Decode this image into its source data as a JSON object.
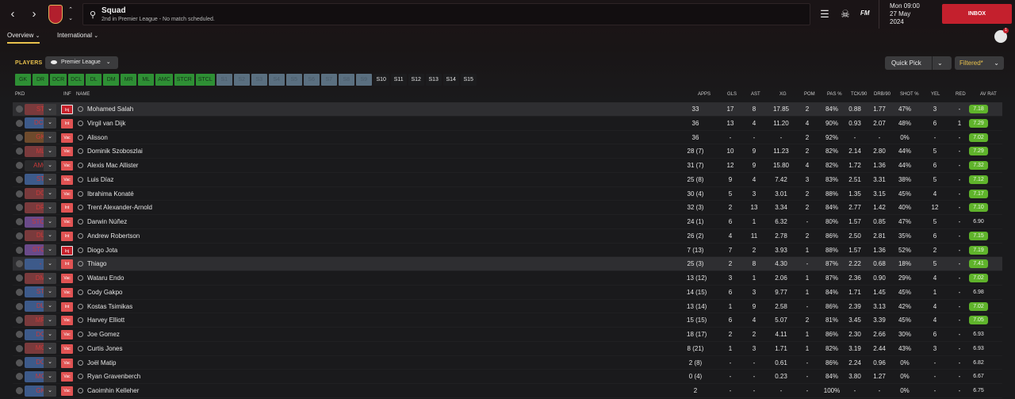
{
  "topbar": {
    "back_icon": "chevron-left",
    "forward_icon": "chevron-right",
    "club_crest": "liverpool-crest",
    "title": "Squad",
    "subtitle": "2nd in Premier League - No match scheduled.",
    "menu_icon": "hamburger-menu",
    "time": "Mon 09:00",
    "date": "27 May",
    "year": "2024",
    "fm_label": "FM",
    "inbox_label": "INBOX",
    "inbox_color": "#c4202d"
  },
  "tabs": [
    {
      "label": "Overview"
    },
    {
      "label": "International"
    }
  ],
  "notification_count": "1",
  "filters": {
    "players_label": "PLAYERS",
    "competition": "Premier League",
    "quick_pick": "Quick Pick",
    "filtered": "Filtered*",
    "positions": [
      "GK",
      "DR",
      "DCR",
      "DCL",
      "DL",
      "DM",
      "MR",
      "ML",
      "AMC",
      "STCR",
      "STCL",
      "S1",
      "S2",
      "S3",
      "S4",
      "S5",
      "S6",
      "S7",
      "S8",
      "S9",
      "S10",
      "S11",
      "S12",
      "S13",
      "S14",
      "S15"
    ]
  },
  "table": {
    "headers": {
      "pkd": "PKD",
      "inf": "INF",
      "name": "NAME",
      "apps": "APPS",
      "gls": "GLS",
      "ast": "AST",
      "xg": "XG",
      "pom": "POM",
      "pas": "PAS %",
      "tck": "TCK/90",
      "drb": "DRB/90",
      "shot": "SHOT %",
      "yel": "YEL",
      "red": "RED",
      "avrat": "AV RAT"
    },
    "rows": [
      {
        "pos": "ST",
        "pos_color": "#7a3a3c",
        "inf": "Inj",
        "name": "Mohamed Salah",
        "apps": "33",
        "gls": "17",
        "ast": "8",
        "xg": "17.85",
        "pom": "2",
        "pas": "84%",
        "tck": "0.88",
        "drb": "1.77",
        "shot": "47%",
        "yel": "3",
        "red": "-",
        "avrat": "7.18"
      },
      {
        "pos": "DCL",
        "pos_color": "#3d5a8a",
        "inf": "Int",
        "name": "Virgil van Dijk",
        "apps": "36",
        "gls": "13",
        "ast": "4",
        "xg": "11.20",
        "pom": "4",
        "pas": "90%",
        "tck": "0.93",
        "drb": "2.07",
        "shot": "48%",
        "yel": "6",
        "red": "1",
        "avrat": "7.29"
      },
      {
        "pos": "GK",
        "pos_color": "#6e4a2c",
        "inf": "Vac",
        "name": "Alisson",
        "apps": "36",
        "gls": "-",
        "ast": "-",
        "xg": "-",
        "pom": "2",
        "pas": "92%",
        "tck": "-",
        "drb": "-",
        "shot": "0%",
        "yel": "-",
        "red": "-",
        "avrat": "7.02"
      },
      {
        "pos": "ML",
        "pos_color": "#7a3a3c",
        "inf": "Vac",
        "name": "Dominik Szoboszlai",
        "apps": "28 (7)",
        "gls": "10",
        "ast": "9",
        "xg": "11.23",
        "pom": "2",
        "pas": "82%",
        "tck": "2.14",
        "drb": "2.80",
        "shot": "44%",
        "yel": "5",
        "red": "-",
        "avrat": "7.29"
      },
      {
        "pos": "AMC",
        "pos_color": "#2a2a2c",
        "inf": "Vac",
        "name": "Alexis Mac Allister",
        "apps": "31 (7)",
        "gls": "12",
        "ast": "9",
        "xg": "15.80",
        "pom": "4",
        "pas": "82%",
        "tck": "1.72",
        "drb": "1.36",
        "shot": "44%",
        "yel": "6",
        "red": "-",
        "avrat": "7.32"
      },
      {
        "pos": "ST",
        "pos_color": "#3d5a8a",
        "inf": "Vac",
        "name": "Luis Díaz",
        "apps": "25 (8)",
        "gls": "9",
        "ast": "4",
        "xg": "7.42",
        "pom": "3",
        "pas": "83%",
        "tck": "2.51",
        "drb": "3.31",
        "shot": "38%",
        "yel": "5",
        "red": "-",
        "avrat": "7.12"
      },
      {
        "pos": "DC",
        "pos_color": "#7a3a3c",
        "inf": "Vac",
        "name": "Ibrahima Konaté",
        "apps": "30 (4)",
        "gls": "5",
        "ast": "3",
        "xg": "3.01",
        "pom": "2",
        "pas": "88%",
        "tck": "1.35",
        "drb": "3.15",
        "shot": "45%",
        "yel": "4",
        "red": "-",
        "avrat": "7.17"
      },
      {
        "pos": "DR",
        "pos_color": "#7a3a3c",
        "inf": "Int",
        "name": "Trent Alexander-Arnold",
        "apps": "32 (3)",
        "gls": "2",
        "ast": "13",
        "xg": "3.34",
        "pom": "2",
        "pas": "84%",
        "tck": "2.77",
        "drb": "1.42",
        "shot": "40%",
        "yel": "12",
        "red": "-",
        "avrat": "7.10"
      },
      {
        "pos": "STCR",
        "pos_color": "#6a4a8a",
        "inf": "Vac",
        "name": "Darwin Núñez",
        "apps": "24 (1)",
        "gls": "6",
        "ast": "1",
        "xg": "6.32",
        "pom": "-",
        "pas": "80%",
        "tck": "1.57",
        "drb": "0.85",
        "shot": "47%",
        "yel": "5",
        "red": "-",
        "avrat": "6.90"
      },
      {
        "pos": "DL",
        "pos_color": "#7a3a3c",
        "inf": "Int",
        "name": "Andrew Robertson",
        "apps": "26 (2)",
        "gls": "4",
        "ast": "11",
        "xg": "2.78",
        "pom": "2",
        "pas": "86%",
        "tck": "2.50",
        "drb": "2.81",
        "shot": "35%",
        "yel": "6",
        "red": "-",
        "avrat": "7.15"
      },
      {
        "pos": "STCL",
        "pos_color": "#6a4a8a",
        "inf": "Inj",
        "name": "Diogo Jota",
        "apps": "7 (13)",
        "gls": "7",
        "ast": "2",
        "xg": "3.93",
        "pom": "1",
        "pas": "88%",
        "tck": "1.57",
        "drb": "1.36",
        "shot": "52%",
        "yel": "2",
        "red": "-",
        "avrat": "7.19"
      },
      {
        "pos": "-",
        "pos_color": "#3d5a8a",
        "inf": "Int",
        "name": "Thiago",
        "apps": "25 (3)",
        "gls": "2",
        "ast": "8",
        "xg": "4.30",
        "pom": "-",
        "pas": "87%",
        "tck": "2.22",
        "drb": "0.68",
        "shot": "18%",
        "yel": "5",
        "red": "-",
        "avrat": "7.41"
      },
      {
        "pos": "DM",
        "pos_color": "#7a3a3c",
        "inf": "Vac",
        "name": "Wataru Endo",
        "apps": "13 (12)",
        "gls": "3",
        "ast": "1",
        "xg": "2.06",
        "pom": "1",
        "pas": "87%",
        "tck": "2.36",
        "drb": "0.90",
        "shot": "29%",
        "yel": "4",
        "red": "-",
        "avrat": "7.02"
      },
      {
        "pos": "ST",
        "pos_color": "#3d5a8a",
        "inf": "Vac",
        "name": "Cody Gakpo",
        "apps": "14 (15)",
        "gls": "6",
        "ast": "3",
        "xg": "9.77",
        "pom": "1",
        "pas": "84%",
        "tck": "1.71",
        "drb": "1.45",
        "shot": "45%",
        "yel": "1",
        "red": "-",
        "avrat": "6.98"
      },
      {
        "pos": "DL",
        "pos_color": "#3d5a8a",
        "inf": "Int",
        "name": "Kostas Tsimikas",
        "apps": "13 (14)",
        "gls": "1",
        "ast": "9",
        "xg": "2.58",
        "pom": "-",
        "pas": "86%",
        "tck": "2.39",
        "drb": "3.13",
        "shot": "42%",
        "yel": "4",
        "red": "-",
        "avrat": "7.02"
      },
      {
        "pos": "MR",
        "pos_color": "#7a3a3c",
        "inf": "Vac",
        "name": "Harvey Elliott",
        "apps": "15 (15)",
        "gls": "6",
        "ast": "4",
        "xg": "5.07",
        "pom": "2",
        "pas": "81%",
        "tck": "3.45",
        "drb": "3.39",
        "shot": "45%",
        "yel": "4",
        "red": "-",
        "avrat": "7.05"
      },
      {
        "pos": "DC",
        "pos_color": "#3d5a8a",
        "inf": "Vac",
        "name": "Joe Gomez",
        "apps": "18 (17)",
        "gls": "2",
        "ast": "2",
        "xg": "4.11",
        "pom": "1",
        "pas": "86%",
        "tck": "2.30",
        "drb": "2.66",
        "shot": "30%",
        "yel": "6",
        "red": "-",
        "avrat": "6.93"
      },
      {
        "pos": "MC",
        "pos_color": "#7a3a3c",
        "inf": "Vac",
        "name": "Curtis Jones",
        "apps": "8 (21)",
        "gls": "1",
        "ast": "3",
        "xg": "1.71",
        "pom": "1",
        "pas": "82%",
        "tck": "3.19",
        "drb": "2.44",
        "shot": "43%",
        "yel": "3",
        "red": "-",
        "avrat": "6.93"
      },
      {
        "pos": "DC",
        "pos_color": "#3d5a8a",
        "inf": "Vac",
        "name": "Joël Matip",
        "apps": "2 (8)",
        "gls": "-",
        "ast": "-",
        "xg": "0.61",
        "pom": "-",
        "pas": "86%",
        "tck": "2.24",
        "drb": "0.96",
        "shot": "0%",
        "yel": "-",
        "red": "-",
        "avrat": "6.82"
      },
      {
        "pos": "MC",
        "pos_color": "#3d5a8a",
        "inf": "Vac",
        "name": "Ryan Gravenberch",
        "apps": "0 (4)",
        "gls": "-",
        "ast": "-",
        "xg": "0.23",
        "pom": "-",
        "pas": "84%",
        "tck": "3.80",
        "drb": "1.27",
        "shot": "0%",
        "yel": "-",
        "red": "-",
        "avrat": "6.67"
      },
      {
        "pos": "GK",
        "pos_color": "#3d5a8a",
        "inf": "Vac",
        "name": "Caoimhin Kelleher",
        "apps": "2",
        "gls": "-",
        "ast": "-",
        "xg": "-",
        "pom": "-",
        "pas": "100%",
        "tck": "-",
        "drb": "-",
        "shot": "0%",
        "yel": "-",
        "red": "-",
        "avrat": "6.75"
      }
    ]
  }
}
